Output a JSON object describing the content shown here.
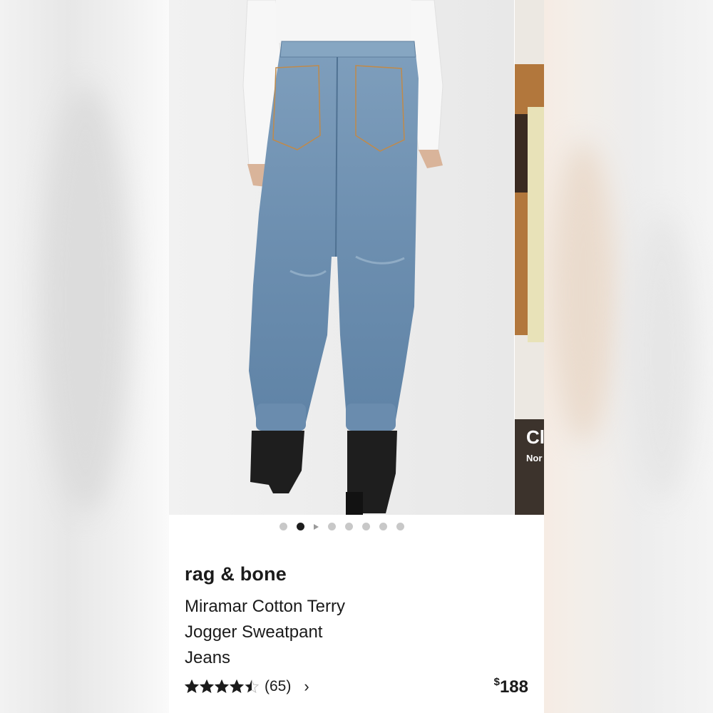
{
  "product": {
    "brand": "rag & bone",
    "name_lines": [
      "Miramar Cotton Terry",
      "Jogger Sweatpant",
      "Jeans"
    ],
    "rating": 4.5,
    "rating_max": 5,
    "review_count": "(65)",
    "price_symbol": "$",
    "price_amount": "188"
  },
  "gallery": {
    "image_count": 8,
    "active_index": 1,
    "video_indicator_index": 2
  },
  "next_card": {
    "title_fragment": "Cl",
    "subtitle_fragment": "Nor"
  },
  "icons": {
    "star": "star-icon",
    "chevron": "chevron-right-icon",
    "play": "play-icon"
  },
  "colors": {
    "text": "#1b1b1b",
    "dot_active": "#1d1d1d",
    "dot_inactive": "#c8c8c8",
    "star": "#1b1b1b"
  }
}
